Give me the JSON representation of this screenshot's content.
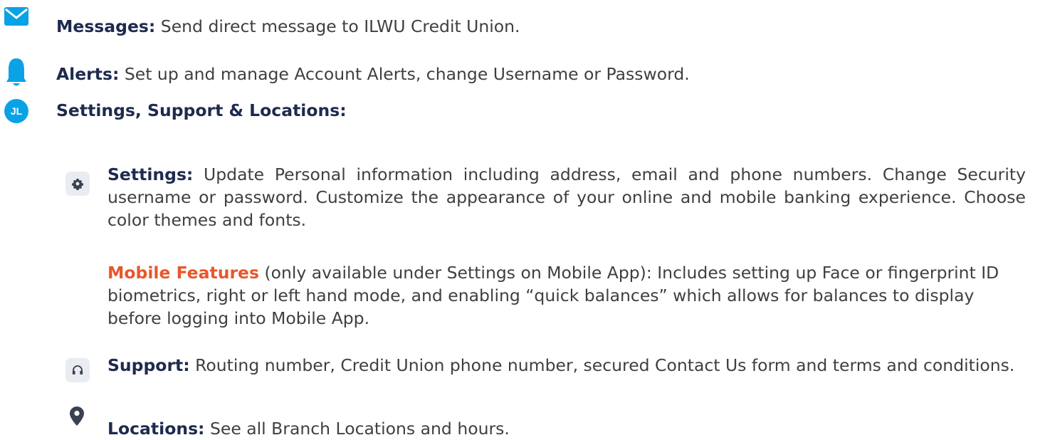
{
  "messages": {
    "label": "Messages:",
    "text": " Send direct message to ILWU Credit Union."
  },
  "alerts": {
    "label": "Alerts:",
    "text": " Set up and manage Account Alerts, change Username or Password."
  },
  "profile": {
    "initials": "JL",
    "heading": "Settings, Support & Locations:"
  },
  "settings": {
    "label": "Settings:",
    "text": " Update Personal information including address, email and phone numbers. Change Security username or password. Customize the appearance of your online and mobile banking experience. Choose color themes and fonts."
  },
  "mobile_features": {
    "label": "Mobile Features",
    "text": " (only available under Settings on Mobile App): Includes setting up Face or fingerprint ID biometrics, right or left hand mode, and enabling “quick balances” which allows for balances to display before logging into Mobile App."
  },
  "support": {
    "label": "Support:",
    "text": " Routing number, Credit Union phone number, secured Contact Us form and terms and conditions."
  },
  "locations": {
    "label": "Locations:",
    "text": " See all Branch Locations and hours."
  },
  "colors": {
    "accent_blue": "#0aa2e6",
    "heading_navy": "#1e2a4e",
    "highlight_orange": "#e8572a"
  }
}
